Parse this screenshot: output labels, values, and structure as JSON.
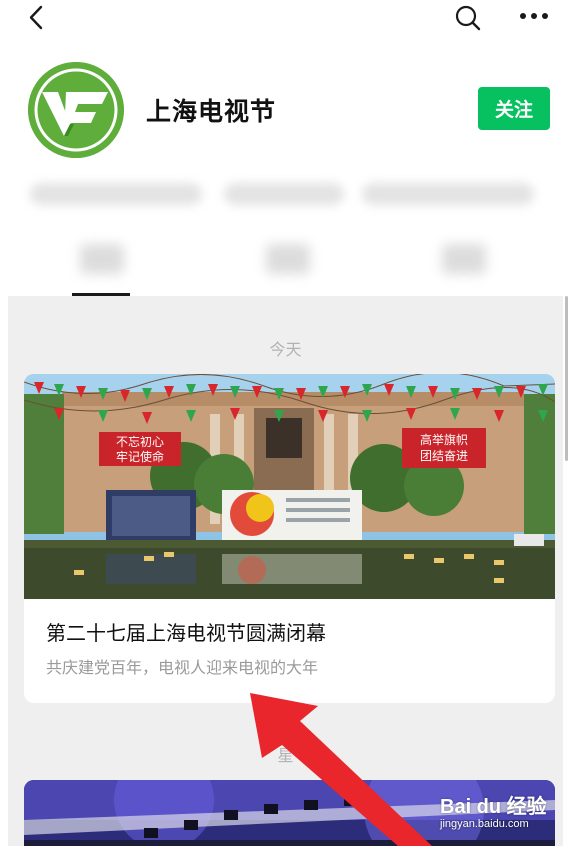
{
  "header": {
    "back_icon": "chevron-left-icon",
    "search_icon": "search-icon",
    "more_icon": "more-horizontal-icon"
  },
  "profile": {
    "name": "上海电视节",
    "follow_label": "关注",
    "logo_text": "VF",
    "logo_color": "#5fae3c",
    "follow_color": "#07c160"
  },
  "feed": {
    "date_today": "今天",
    "date_star": "星",
    "articles": [
      {
        "title": "第二十七届上海电视节圆满闭幕",
        "subtitle": "共庆建党百年，电视人迎来电视的大年",
        "banner_left": [
          "不忘初心",
          "牢记使命"
        ],
        "banner_right": [
          "高举旗帜",
          "团结奋进"
        ]
      }
    ]
  },
  "watermark": {
    "brand": "Bai du 经验",
    "url": "jingyan.baidu.com"
  },
  "annotation": {
    "arrow_color": "#e8262b"
  }
}
